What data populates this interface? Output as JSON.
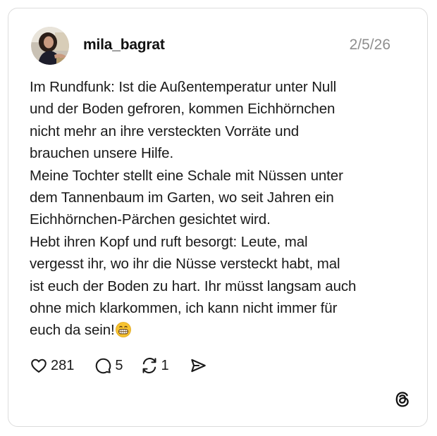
{
  "post": {
    "username": "mila_bagrat",
    "timestamp": "2/5/26",
    "text_lines": [
      "Im Rundfunk: Ist die Außentemperatur unter Null",
      "und der Boden gefroren, kommen Eichhörnchen",
      "nicht mehr an ihre versteckten Vorräte und",
      "brauchen unsere Hilfe.",
      "Meine Tochter stellt eine Schale mit Nüssen unter",
      "dem Tannenbaum im Garten, wo seit Jahren ein",
      "Eichhörnchen-Pärchen gesichtet wird.",
      "Hebt ihren Kopf und ruft besorgt: Leute, mal",
      "vergesst ihr, wo ihr die Nüsse versteckt habt, mal",
      "ist euch der Boden zu hart. Ihr müsst langsam auch",
      "ohne mich klarkommen, ich kann nicht immer für",
      "euch da sein!"
    ],
    "end_emoji": "grinning-face-emoji"
  },
  "actions": {
    "likes": "281",
    "replies": "5",
    "reposts": "1"
  },
  "icons": {
    "like": "heart-icon",
    "reply": "comment-bubble-icon",
    "repost": "repost-icon",
    "share": "send-icon",
    "brand": "threads-logo-icon"
  },
  "colors": {
    "timestamp": "#8e8e8e",
    "text": "#1a1a1a",
    "border": "#dcdcdc"
  }
}
